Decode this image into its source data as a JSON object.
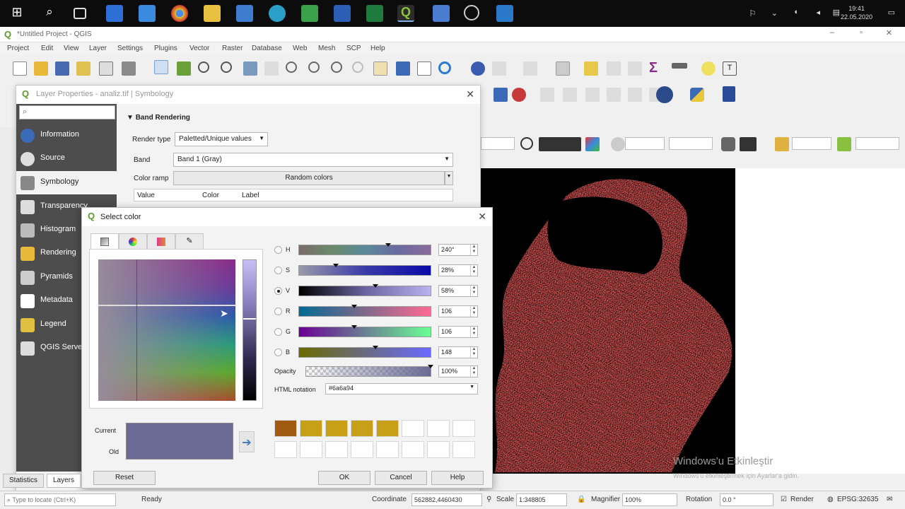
{
  "taskbar": {
    "time": "19:41",
    "date": "22.05.2020"
  },
  "app": {
    "title": "*Untitled Project - QGIS",
    "menu": [
      "Project",
      "Edit",
      "View",
      "Layer",
      "Settings",
      "Plugins",
      "Vector",
      "Raster",
      "Database",
      "Web",
      "Mesh",
      "SCP",
      "Help"
    ]
  },
  "layer_properties": {
    "title": "Layer Properties - analiz.tif | Symbology",
    "sidebar": [
      "Information",
      "Source",
      "Symbology",
      "Transparency",
      "Histogram",
      "Rendering",
      "Pyramids",
      "Metadata",
      "Legend",
      "QGIS Server"
    ],
    "section_title": "Band Rendering",
    "render_type_label": "Render type",
    "render_type_value": "Paletted/Unique values",
    "band_label": "Band",
    "band_value": "Band 1 (Gray)",
    "color_ramp_label": "Color ramp",
    "color_ramp_value": "Random colors",
    "table_headers": [
      "Value",
      "Color",
      "Label"
    ]
  },
  "select_color": {
    "title": "Select color",
    "rows": [
      {
        "key": "H",
        "value": "240°",
        "thumb": 0.68,
        "gradient": "linear-gradient(to right,#7a6a6a,#6a8a6a,#5a8a9a,#6a6aa0,#8a6a9a)"
      },
      {
        "key": "S",
        "value": "28%",
        "thumb": 0.28,
        "gradient": "linear-gradient(to right,#9a9aa8,#3a3aa8,#0a0aa8)"
      },
      {
        "key": "V",
        "value": "58%",
        "thumb": 0.58,
        "gradient": "linear-gradient(to right,#000000,#6a65a0,#b8b2f0)"
      },
      {
        "key": "R",
        "value": "106",
        "thumb": 0.42,
        "gradient": "linear-gradient(to right,#006a94,#80688a,#ff6a94)"
      },
      {
        "key": "G",
        "value": "106",
        "thumb": 0.42,
        "gradient": "linear-gradient(to right,#6a0094,#6a8094,#6aff94)"
      },
      {
        "key": "B",
        "value": "148",
        "thumb": 0.58,
        "gradient": "linear-gradient(to right,#6a6a00,#6a6a80,#6a6aff)"
      }
    ],
    "selected_row": "V",
    "opacity_label": "Opacity",
    "opacity_value": "100%",
    "html_label": "HTML notation",
    "html_value": "#6a6a94",
    "current_label": "Current",
    "old_label": "Old",
    "current_color": "#6a6a94",
    "swatches": [
      "#a05a10",
      "#c8a018",
      "#c8a018",
      "#c8a018",
      "#c8a018"
    ],
    "buttons": {
      "reset": "Reset",
      "ok": "OK",
      "cancel": "Cancel",
      "help": "Help"
    }
  },
  "bottom_tabs": [
    "Statistics",
    "Layers"
  ],
  "status": {
    "locate_placeholder": "Type to locate (Ctrl+K)",
    "ready": "Ready",
    "coordinate_label": "Coordinate",
    "coordinate_value": "562882,4460430",
    "scale_label": "Scale",
    "scale_value": "1:348805",
    "magnifier_label": "Magnifier",
    "magnifier_value": "100%",
    "rotation_label": "Rotation",
    "rotation_value": "0.0 °",
    "render_label": "Render",
    "crs": "EPSG:32635"
  },
  "watermark": {
    "title": "Windows'u Etkinleştir",
    "subtitle": "Windows'u etkinleştirmek için Ayarlar'a gidin."
  },
  "colors": {
    "qgis_green": "#5a9a2a",
    "raster_red": "#d42020"
  }
}
